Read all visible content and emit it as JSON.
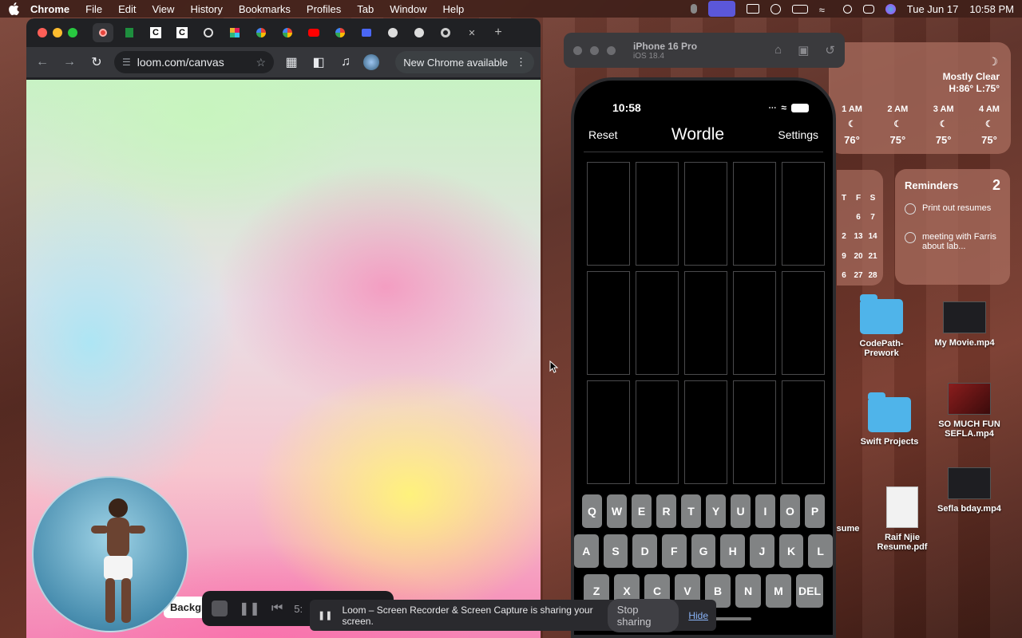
{
  "menubar": {
    "app": "Chrome",
    "items": [
      "File",
      "Edit",
      "View",
      "History",
      "Bookmarks",
      "Profiles",
      "Tab",
      "Window",
      "Help"
    ],
    "date": "Tue Jun 17",
    "time": "10:58 PM"
  },
  "chrome": {
    "tabs": [
      "",
      "",
      "C",
      "C",
      "",
      "",
      "",
      "",
      "",
      "",
      "",
      "",
      ""
    ],
    "url": "loom.com/canvas",
    "update_label": "New Chrome available"
  },
  "loom": {
    "time": "5:",
    "background_chip": "Backgr",
    "share_message": "Loom – Screen Recorder & Screen Capture is sharing your screen.",
    "stop_label": "Stop sharing",
    "hide_label": "Hide"
  },
  "simulator": {
    "device": "iPhone 16 Pro",
    "os": "iOS 18.4",
    "phone_time": "10:58",
    "wordle": {
      "reset": "Reset",
      "title": "Wordle",
      "settings": "Settings"
    },
    "keyboard": {
      "row1": [
        "Q",
        "W",
        "E",
        "R",
        "T",
        "Y",
        "U",
        "I",
        "O",
        "P"
      ],
      "row2": [
        "A",
        "S",
        "D",
        "F",
        "G",
        "H",
        "J",
        "K",
        "L"
      ],
      "row3": [
        "Z",
        "X",
        "C",
        "V",
        "B",
        "N",
        "M",
        "DEL"
      ]
    }
  },
  "weather": {
    "condition": "Mostly Clear",
    "hilo": "H:86° L:75°",
    "hours": [
      {
        "label": "1 AM",
        "temp": "76°"
      },
      {
        "label": "2 AM",
        "temp": "75°"
      },
      {
        "label": "3 AM",
        "temp": "75°"
      },
      {
        "label": "4 AM",
        "temp": "75°"
      }
    ]
  },
  "calendar": {
    "cells": [
      "T",
      "F",
      "S",
      "",
      "6",
      "7",
      "2",
      "13",
      "14",
      "9",
      "20",
      "21",
      "6",
      "27",
      "28"
    ]
  },
  "reminders": {
    "title": "Reminders",
    "count": "2",
    "items": [
      "Print out resumes",
      "meeting with Farris about lab..."
    ]
  },
  "desktop": {
    "codepath": "CodePath-Prework",
    "movie": "My Movie.mp4",
    "swift": "Swift Projects",
    "fun": "SO MUCH FUN SEFLA.mp4",
    "bday": "Sefla bday.mp4",
    "resume": "Raif Njie Resume.pdf",
    "resume_partial": "sume"
  }
}
